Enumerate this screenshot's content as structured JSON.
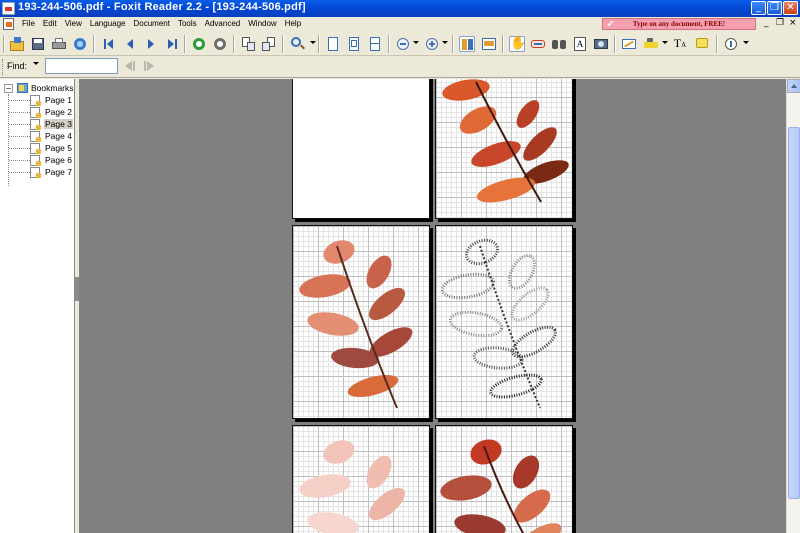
{
  "window": {
    "title": "193-244-506.pdf - Foxit Reader 2.2 - [193-244-506.pdf]",
    "minimize_glyph": "_",
    "maximize_glyph": "❐",
    "close_glyph": "✕"
  },
  "menubar": {
    "items": [
      "File",
      "Edit",
      "View",
      "Language",
      "Document",
      "Tools",
      "Advanced",
      "Window",
      "Help"
    ],
    "ad_text": "Type on any document, FREE!",
    "mdi_minimize": "_",
    "mdi_restore": "❐",
    "mdi_close": "×"
  },
  "toolbar": {
    "icons": [
      "open-icon",
      "save-icon",
      "print-icon",
      "email-icon",
      "first-page-icon",
      "previous-page-icon",
      "next-page-icon",
      "last-page-icon",
      "go-back-icon",
      "go-forward-icon",
      "rotate-left-icon",
      "rotate-right-icon",
      "zoom-tool-icon",
      "actual-size-icon",
      "fit-page-icon",
      "fit-width-icon",
      "zoom-out-icon",
      "zoom-in-icon",
      "single-page-icon",
      "continuous-icon",
      "hand-tool-icon",
      "text-select-icon",
      "find-icon",
      "typewriter-icon",
      "snapshot-icon",
      "pencil-icon",
      "highlight-icon",
      "text-tool-icon",
      "note-icon",
      "info-icon"
    ]
  },
  "findbar": {
    "label": "Find:",
    "value": "",
    "placeholder": ""
  },
  "bookmarks": {
    "root_label": "Bookmarks",
    "expander": "−",
    "items": [
      "Page 1",
      "Page 2",
      "Page 3",
      "Page 4",
      "Page 5",
      "Page 6",
      "Page 7"
    ],
    "selected_index": 2
  },
  "document": {
    "pages": [
      {
        "label": "page-blank",
        "style": "blank"
      },
      {
        "label": "page-orange-leaf",
        "style": "orange"
      },
      {
        "label": "page-pink-leaf",
        "style": "pink"
      },
      {
        "label": "page-symbol-leaf",
        "style": "symbols"
      },
      {
        "label": "page-faded-leaf",
        "style": "faded"
      },
      {
        "label": "page-red-leaf",
        "style": "red"
      }
    ]
  },
  "colors": {
    "titlebar": "#0A5DE8",
    "canvas": "#808080",
    "leaf_orange": "#D9582B",
    "leaf_dark": "#7A2A14",
    "leaf_pink": "#E3866E",
    "leaf_faded": "#F2C3B8",
    "leaf_red": "#C23A24"
  }
}
